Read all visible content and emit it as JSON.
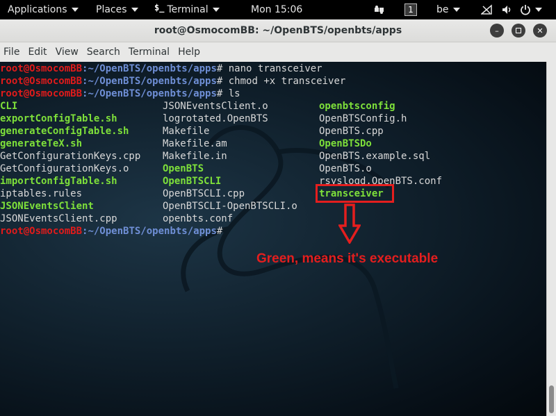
{
  "topbar": {
    "applications": "Applications",
    "places": "Places",
    "app_name": "Terminal",
    "clock": "Mon 15:06",
    "workspace": "1",
    "keyboard_layout": "be"
  },
  "window": {
    "title": "root@OsmocomBB: ~/OpenBTS/openbts/apps"
  },
  "menubar": [
    "File",
    "Edit",
    "View",
    "Search",
    "Terminal",
    "Help"
  ],
  "terminal": {
    "prompt_user": "root@OsmocomBB",
    "prompt_path": ":~/OpenBTS/openbts/apps",
    "commands": [
      "nano transceiver",
      "chmod +x transceiver",
      "ls",
      ""
    ],
    "ls_columns": [
      [
        {
          "name": "CLI",
          "exec": true
        },
        {
          "name": "exportConfigTable.sh",
          "exec": true
        },
        {
          "name": "generateConfigTable.sh",
          "exec": true
        },
        {
          "name": "generateTeX.sh",
          "exec": true
        },
        {
          "name": "GetConfigurationKeys.cpp",
          "exec": false
        },
        {
          "name": "GetConfigurationKeys.o",
          "exec": false
        },
        {
          "name": "importConfigTable.sh",
          "exec": true
        },
        {
          "name": "iptables.rules",
          "exec": false
        },
        {
          "name": "JSONEventsClient",
          "exec": true
        },
        {
          "name": "JSONEventsClient.cpp",
          "exec": false
        }
      ],
      [
        {
          "name": "JSONEventsClient.o",
          "exec": false
        },
        {
          "name": "logrotated.OpenBTS",
          "exec": false
        },
        {
          "name": "Makefile",
          "exec": false
        },
        {
          "name": "Makefile.am",
          "exec": false
        },
        {
          "name": "Makefile.in",
          "exec": false
        },
        {
          "name": "OpenBTS",
          "exec": true
        },
        {
          "name": "OpenBTSCLI",
          "exec": true
        },
        {
          "name": "OpenBTSCLI.cpp",
          "exec": false
        },
        {
          "name": "OpenBTSCLI-OpenBTSCLI.o",
          "exec": false
        },
        {
          "name": "openbts.conf",
          "exec": false
        }
      ],
      [
        {
          "name": "openbtsconfig",
          "exec": true
        },
        {
          "name": "OpenBTSConfig.h",
          "exec": false
        },
        {
          "name": "OpenBTS.cpp",
          "exec": false
        },
        {
          "name": "OpenBTSDo",
          "exec": true
        },
        {
          "name": "OpenBTS.example.sql",
          "exec": false
        },
        {
          "name": "OpenBTS.o",
          "exec": false
        },
        {
          "name": "rsyslogd.OpenBTS.conf",
          "exec": false
        },
        {
          "name": "transceiver",
          "exec": true
        }
      ]
    ]
  },
  "annotation": {
    "text": "Green, means it's executable",
    "color": "#e41e1e"
  },
  "colors": {
    "executable": "#7ee03a",
    "prompt_user": "#e01b1b",
    "prompt_path": "#6f8fd6"
  }
}
